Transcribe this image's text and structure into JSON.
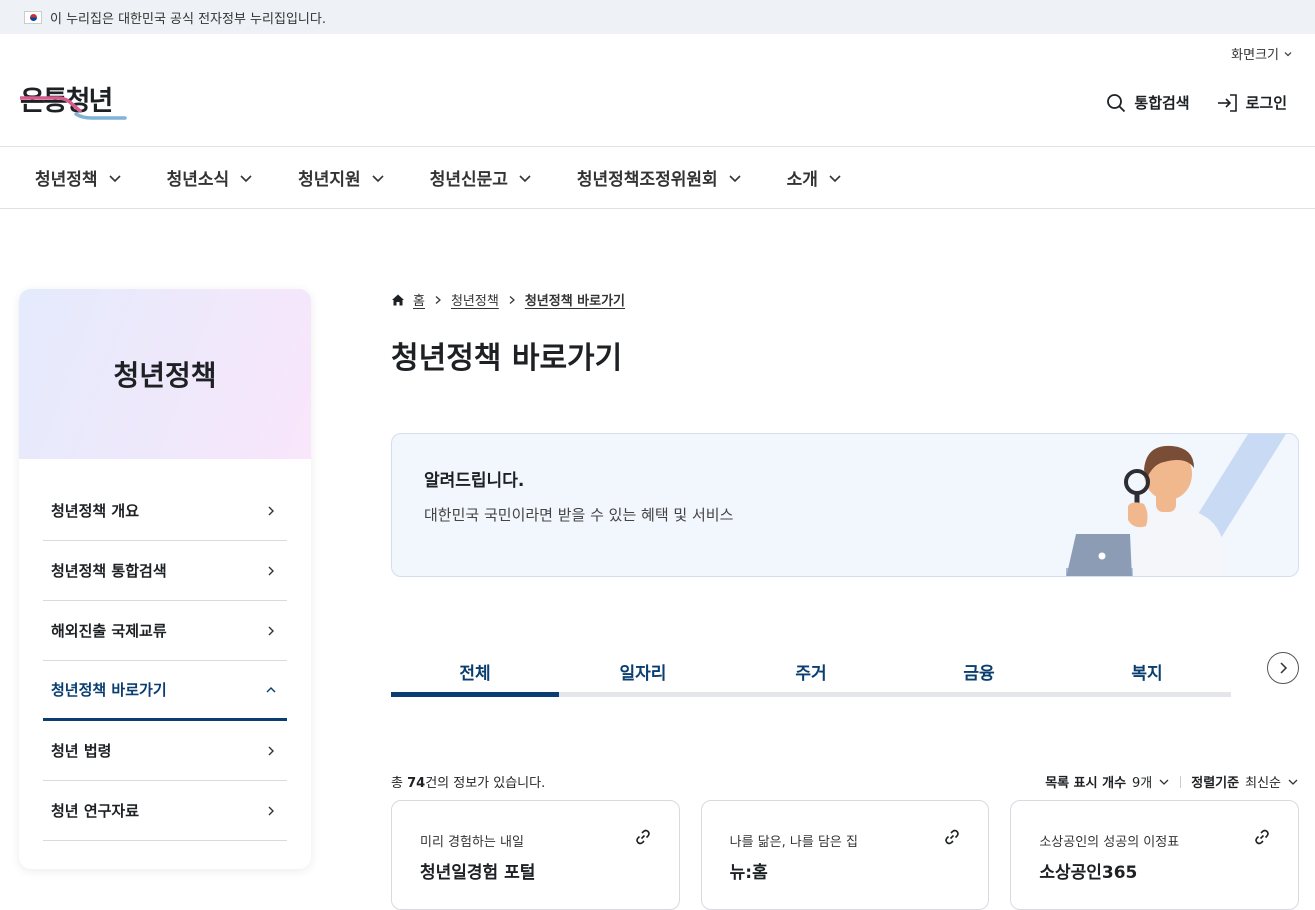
{
  "gov_banner": {
    "text": "이 누리집은 대한민국 공식 전자정부 누리집입니다."
  },
  "header": {
    "screen_size": "화면크기",
    "logo_text": "온통청년",
    "search_label": "통합검색",
    "login_label": "로그인"
  },
  "gnb": [
    {
      "label": "청년정책"
    },
    {
      "label": "청년소식"
    },
    {
      "label": "청년지원"
    },
    {
      "label": "청년신문고"
    },
    {
      "label": "청년정책조정위원회"
    },
    {
      "label": "소개"
    }
  ],
  "sidebar": {
    "title": "청년정책",
    "items": [
      {
        "label": "청년정책 개요"
      },
      {
        "label": "청년정책 통합검색"
      },
      {
        "label": "해외진출 국제교류"
      },
      {
        "label": "청년정책 바로가기"
      },
      {
        "label": "청년 법령"
      },
      {
        "label": "청년 연구자료"
      }
    ]
  },
  "breadcrumb": {
    "home": "홈",
    "parent": "청년정책",
    "current": "청년정책 바로가기"
  },
  "page_title": "청년정책 바로가기",
  "notice": {
    "title": "알려드립니다.",
    "desc": "대한민국 국민이라면 받을 수 있는 혜택 및 서비스"
  },
  "tabs": [
    {
      "label": "전체"
    },
    {
      "label": "일자리"
    },
    {
      "label": "주거"
    },
    {
      "label": "금융"
    },
    {
      "label": "복지"
    }
  ],
  "list": {
    "total_prefix": "총 ",
    "total_count": "74",
    "total_suffix": "건의 정보가 있습니다.",
    "display_label": "목록 표시 개수",
    "display_value": "9개",
    "sort_label": "정렬기준",
    "sort_value": "최신순"
  },
  "cards": [
    {
      "sub": "미리 경험하는 내일",
      "title": "청년일경험 포털"
    },
    {
      "sub": "나를 닮은, 나를 담은 집",
      "title": "뉴:홈"
    },
    {
      "sub": "소상공인의 성공의 이정표",
      "title": "소상공인365"
    }
  ],
  "colors": {
    "primary": "#0b3e70",
    "accent_pink": "#d55c8c",
    "accent_blue": "#7fb4d8"
  }
}
